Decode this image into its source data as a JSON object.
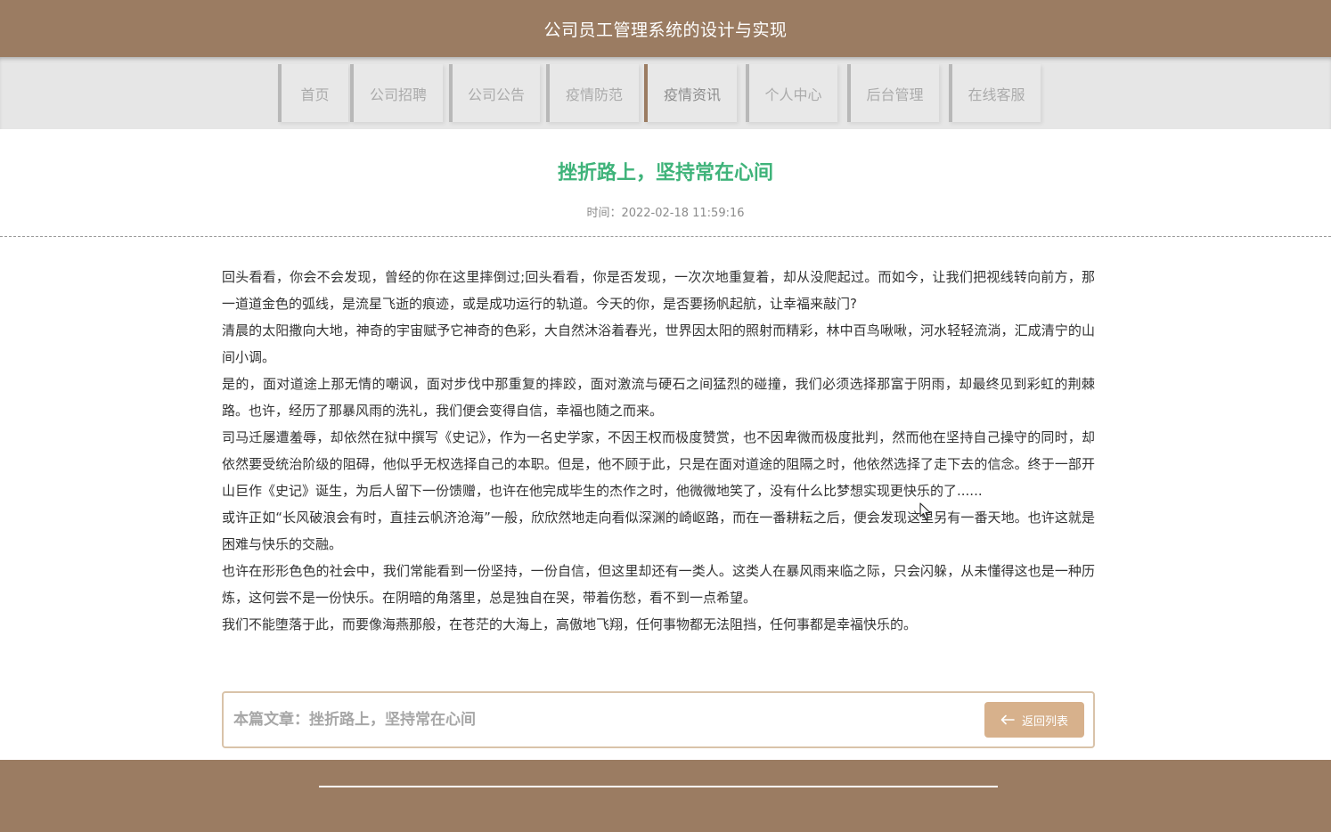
{
  "header": {
    "site_title": "公司员工管理系统的设计与实现"
  },
  "nav": {
    "items": [
      {
        "label": "首页"
      },
      {
        "label": "公司招聘"
      },
      {
        "label": "公司公告"
      },
      {
        "label": "疫情防范"
      },
      {
        "label": "疫情资讯",
        "active": true
      },
      {
        "label": "个人中心"
      },
      {
        "label": "后台管理"
      },
      {
        "label": "在线客服"
      }
    ]
  },
  "article": {
    "title": "挫折路上，坚持常在心间",
    "time": "时间：2022-02-18 11:59:16",
    "paragraphs": [
      "回头看看，你会不会发现，曾经的你在这里摔倒过;回头看看，你是否发现，一次次地重复着，却从没爬起过。而如今，让我们把视线转向前方，那一道道金色的弧线，是流星飞逝的痕迹，或是成功运行的轨道。今天的你，是否要扬帆起航，让幸福来敲门?",
      "清晨的太阳撒向大地，神奇的宇宙赋予它神奇的色彩，大自然沐浴着春光，世界因太阳的照射而精彩，林中百鸟啾啾，河水轻轻流淌，汇成清宁的山间小调。",
      "是的，面对道途上那无情的嘲讽，面对步伐中那重复的摔跤，面对激流与硬石之间猛烈的碰撞，我们必须选择那富于阴雨，却最终见到彩虹的荆棘路。也许，经历了那暴风雨的洗礼，我们便会变得自信，幸福也随之而来。",
      "司马迁屡遭羞辱，却依然在狱中撰写《史记》，作为一名史学家，不因王权而极度赞赏，也不因卑微而极度批判，然而他在坚持自己操守的同时，却依然要受统治阶级的阻碍，他似乎无权选择自己的本职。但是，他不顾于此，只是在面对道途的阻隔之时，他依然选择了走下去的信念。终于一部开山巨作《史记》诞生，为后人留下一份馈赠，也许在他完成毕生的杰作之时，他微微地笑了，没有什么比梦想实现更快乐的了......",
      "或许正如“长风破浪会有时，直挂云帆济沧海”一般，欣欣然地走向看似深渊的崎岖路，而在一番耕耘之后，便会发现这里另有一番天地。也许这就是困难与快乐的交融。",
      "也许在形形色色的社会中，我们常能看到一份坚持，一份自信，但这里却还有一类人。这类人在暴风雨来临之际，只会闪躲，从未懂得这也是一种历炼，这何尝不是一份快乐。在阴暗的角落里，总是独自在哭，带着伤愁，看不到一点希望。",
      "我们不能堕落于此，而要像海燕那般，在苍茫的大海上，高傲地飞翔，任何事物都无法阻挡，任何事都是幸福快乐的。"
    ]
  },
  "article_footer": {
    "article_name": "本篇文章：挫折路上，坚持常在心间",
    "back_label": "返回列表"
  },
  "icons": {
    "back": "arrow-left-icon",
    "cursor": "mouse-cursor-icon"
  },
  "colors": {
    "brand": "#9b7c62",
    "nav_bg": "#e6e6e6",
    "title_green": "#3fb37a",
    "button_bg": "#d7b18c",
    "footer_border": "#d9c3a9"
  }
}
